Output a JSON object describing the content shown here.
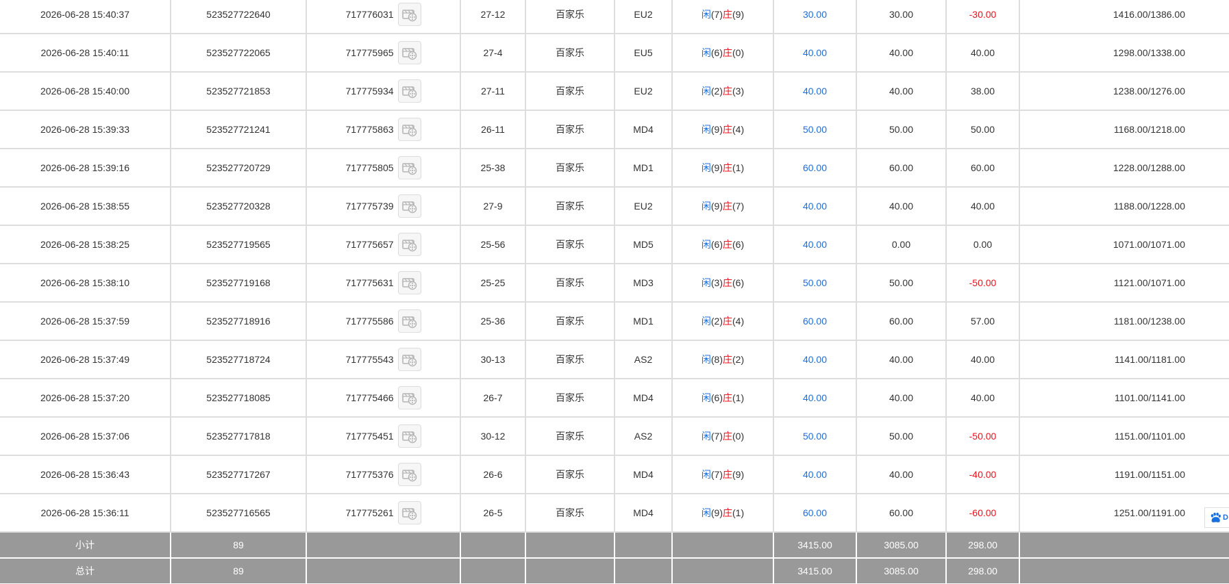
{
  "rows": [
    {
      "time": "2026-06-28 15:40:37",
      "bet_id": "523527722640",
      "round_id": "717776031",
      "shoe": "27-12",
      "game": "百家乐",
      "table": "EU2",
      "player_label": "闲",
      "player_value": "(7)",
      "banker_label": "庄",
      "banker_value": "(9)",
      "bet_amount": "30.00",
      "valid_bet": "30.00",
      "win_loss": "-30.00",
      "win_loss_color": "red",
      "balance": "1416.00/1386.00"
    },
    {
      "time": "2026-06-28 15:40:11",
      "bet_id": "523527722065",
      "round_id": "717775965",
      "shoe": "27-4",
      "game": "百家乐",
      "table": "EU5",
      "player_label": "闲",
      "player_value": "(6)",
      "banker_label": "庄",
      "banker_value": "(0)",
      "bet_amount": "40.00",
      "valid_bet": "40.00",
      "win_loss": "40.00",
      "win_loss_color": "normal",
      "balance": "1298.00/1338.00"
    },
    {
      "time": "2026-06-28 15:40:00",
      "bet_id": "523527721853",
      "round_id": "717775934",
      "shoe": "27-11",
      "game": "百家乐",
      "table": "EU2",
      "player_label": "闲",
      "player_value": "(2)",
      "banker_label": "庄",
      "banker_value": "(3)",
      "bet_amount": "40.00",
      "valid_bet": "40.00",
      "win_loss": "38.00",
      "win_loss_color": "normal",
      "balance": "1238.00/1276.00"
    },
    {
      "time": "2026-06-28 15:39:33",
      "bet_id": "523527721241",
      "round_id": "717775863",
      "shoe": "26-11",
      "game": "百家乐",
      "table": "MD4",
      "player_label": "闲",
      "player_value": "(9)",
      "banker_label": "庄",
      "banker_value": "(4)",
      "bet_amount": "50.00",
      "valid_bet": "50.00",
      "win_loss": "50.00",
      "win_loss_color": "normal",
      "balance": "1168.00/1218.00"
    },
    {
      "time": "2026-06-28 15:39:16",
      "bet_id": "523527720729",
      "round_id": "717775805",
      "shoe": "25-38",
      "game": "百家乐",
      "table": "MD1",
      "player_label": "闲",
      "player_value": "(9)",
      "banker_label": "庄",
      "banker_value": "(1)",
      "bet_amount": "60.00",
      "valid_bet": "60.00",
      "win_loss": "60.00",
      "win_loss_color": "normal",
      "balance": "1228.00/1288.00"
    },
    {
      "time": "2026-06-28 15:38:55",
      "bet_id": "523527720328",
      "round_id": "717775739",
      "shoe": "27-9",
      "game": "百家乐",
      "table": "EU2",
      "player_label": "闲",
      "player_value": "(9)",
      "banker_label": "庄",
      "banker_value": "(7)",
      "bet_amount": "40.00",
      "valid_bet": "40.00",
      "win_loss": "40.00",
      "win_loss_color": "normal",
      "balance": "1188.00/1228.00"
    },
    {
      "time": "2026-06-28 15:38:25",
      "bet_id": "523527719565",
      "round_id": "717775657",
      "shoe": "25-56",
      "game": "百家乐",
      "table": "MD5",
      "player_label": "闲",
      "player_value": "(6)",
      "banker_label": "庄",
      "banker_value": "(6)",
      "bet_amount": "40.00",
      "valid_bet": "0.00",
      "win_loss": "0.00",
      "win_loss_color": "normal",
      "balance": "1071.00/1071.00"
    },
    {
      "time": "2026-06-28 15:38:10",
      "bet_id": "523527719168",
      "round_id": "717775631",
      "shoe": "25-25",
      "game": "百家乐",
      "table": "MD3",
      "player_label": "闲",
      "player_value": "(3)",
      "banker_label": "庄",
      "banker_value": "(6)",
      "bet_amount": "50.00",
      "valid_bet": "50.00",
      "win_loss": "-50.00",
      "win_loss_color": "red",
      "balance": "1121.00/1071.00"
    },
    {
      "time": "2026-06-28 15:37:59",
      "bet_id": "523527718916",
      "round_id": "717775586",
      "shoe": "25-36",
      "game": "百家乐",
      "table": "MD1",
      "player_label": "闲",
      "player_value": "(2)",
      "banker_label": "庄",
      "banker_value": "(4)",
      "bet_amount": "60.00",
      "valid_bet": "60.00",
      "win_loss": "57.00",
      "win_loss_color": "normal",
      "balance": "1181.00/1238.00"
    },
    {
      "time": "2026-06-28 15:37:49",
      "bet_id": "523527718724",
      "round_id": "717775543",
      "shoe": "30-13",
      "game": "百家乐",
      "table": "AS2",
      "player_label": "闲",
      "player_value": "(8)",
      "banker_label": "庄",
      "banker_value": "(2)",
      "bet_amount": "40.00",
      "valid_bet": "40.00",
      "win_loss": "40.00",
      "win_loss_color": "normal",
      "balance": "1141.00/1181.00"
    },
    {
      "time": "2026-06-28 15:37:20",
      "bet_id": "523527718085",
      "round_id": "717775466",
      "shoe": "26-7",
      "game": "百家乐",
      "table": "MD4",
      "player_label": "闲",
      "player_value": "(6)",
      "banker_label": "庄",
      "banker_value": "(1)",
      "bet_amount": "40.00",
      "valid_bet": "40.00",
      "win_loss": "40.00",
      "win_loss_color": "normal",
      "balance": "1101.00/1141.00"
    },
    {
      "time": "2026-06-28 15:37:06",
      "bet_id": "523527717818",
      "round_id": "717775451",
      "shoe": "30-12",
      "game": "百家乐",
      "table": "AS2",
      "player_label": "闲",
      "player_value": "(7)",
      "banker_label": "庄",
      "banker_value": "(0)",
      "bet_amount": "50.00",
      "valid_bet": "50.00",
      "win_loss": "-50.00",
      "win_loss_color": "red",
      "balance": "1151.00/1101.00"
    },
    {
      "time": "2026-06-28 15:36:43",
      "bet_id": "523527717267",
      "round_id": "717775376",
      "shoe": "26-6",
      "game": "百家乐",
      "table": "MD4",
      "player_label": "闲",
      "player_value": "(7)",
      "banker_label": "庄",
      "banker_value": "(9)",
      "bet_amount": "40.00",
      "valid_bet": "40.00",
      "win_loss": "-40.00",
      "win_loss_color": "red",
      "balance": "1191.00/1151.00"
    },
    {
      "time": "2026-06-28 15:36:11",
      "bet_id": "523527716565",
      "round_id": "717775261",
      "shoe": "26-5",
      "game": "百家乐",
      "table": "MD4",
      "player_label": "闲",
      "player_value": "(9)",
      "banker_label": "庄",
      "banker_value": "(1)",
      "bet_amount": "60.00",
      "valid_bet": "60.00",
      "win_loss": "-60.00",
      "win_loss_color": "red",
      "balance": "1251.00/1191.00"
    }
  ],
  "summary": [
    {
      "label": "小计",
      "count": "89",
      "bet_amount": "3415.00",
      "valid_bet": "3085.00",
      "win_loss": "298.00"
    },
    {
      "label": "总计",
      "count": "89",
      "bet_amount": "3415.00",
      "valid_bet": "3085.00",
      "win_loss": "298.00"
    }
  ],
  "icons": {
    "replay": "film-reel-icon",
    "side_widget": "paw-icon"
  },
  "side_widget": {
    "tail_text": "D"
  },
  "colors": {
    "blue": "#1a6fe0",
    "red": "#e8121a",
    "grid": "#dddddd",
    "summary_bg": "#999999",
    "summary_text": "#ffffff"
  }
}
